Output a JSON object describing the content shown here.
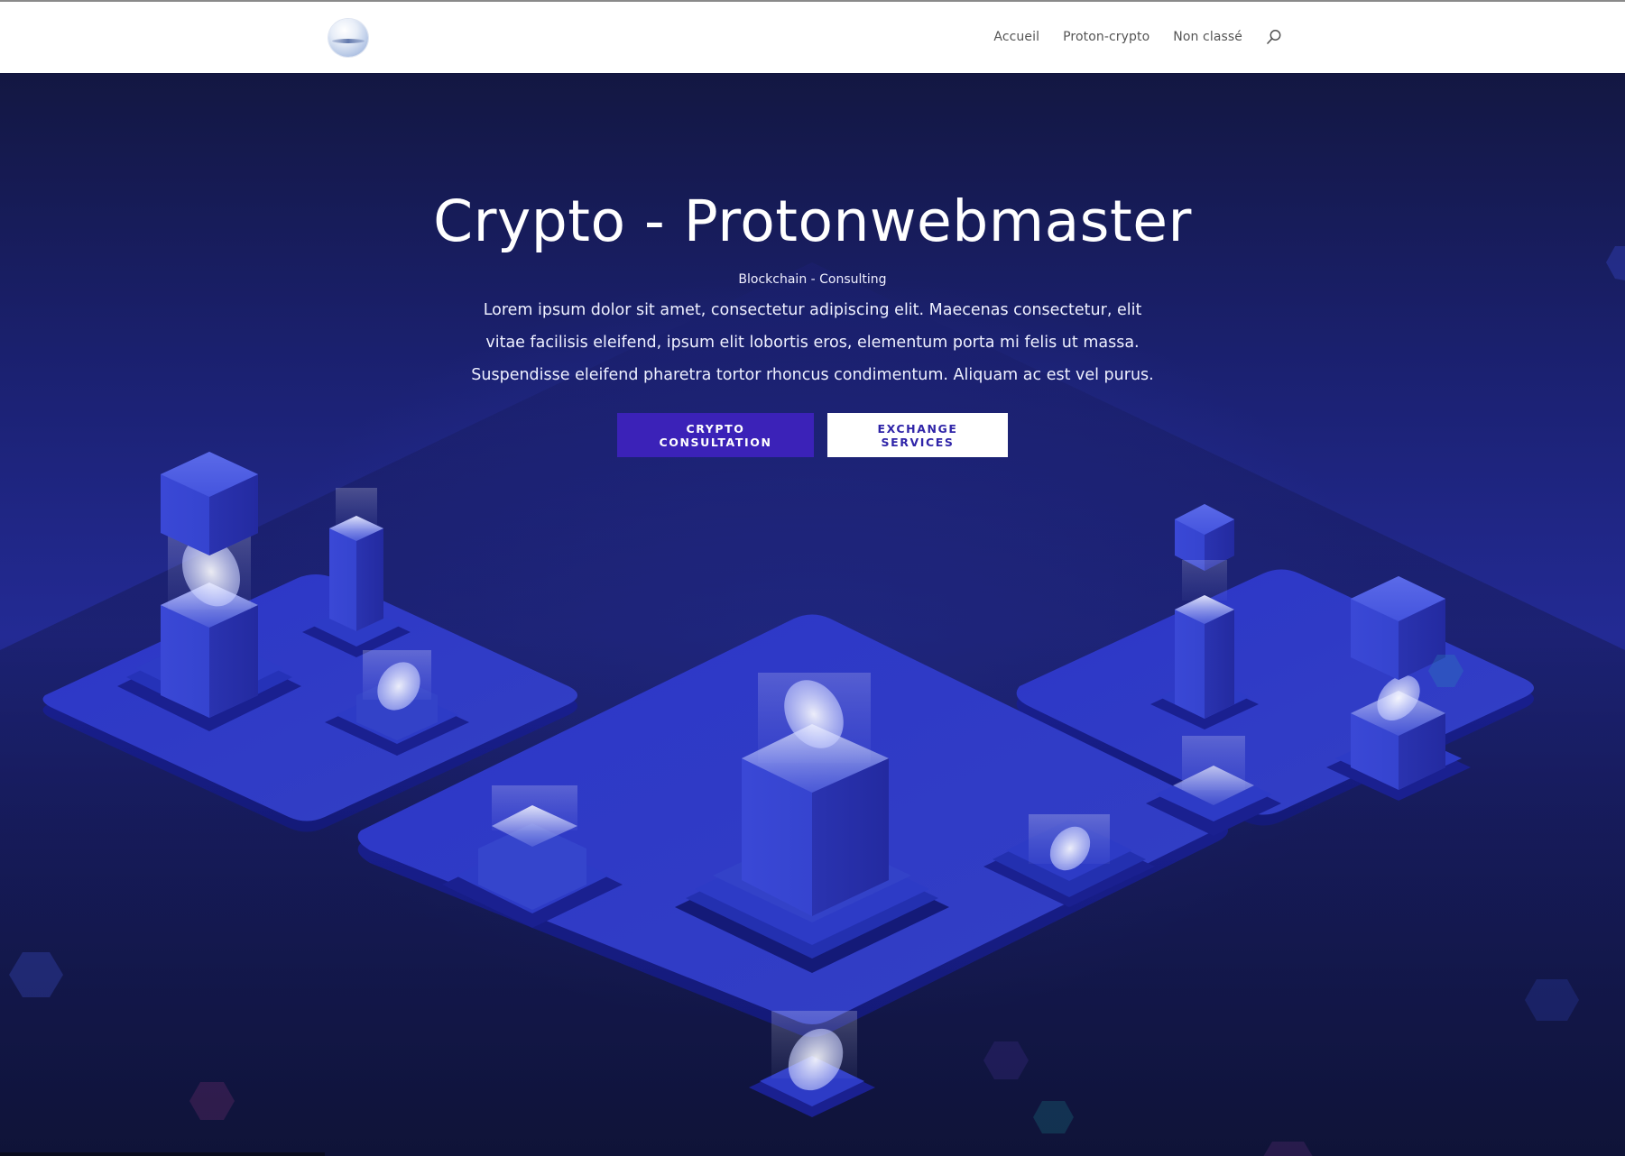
{
  "header": {
    "logo_name": "globe-logo",
    "nav": [
      {
        "label": "Accueil"
      },
      {
        "label": "Proton-crypto"
      },
      {
        "label": "Non classé"
      }
    ],
    "search_icon": "search-icon"
  },
  "hero": {
    "title": "Crypto - Protonwebmaster",
    "subtitle": "Blockchain - Consulting",
    "text": "Lorem ipsum dolor sit amet, consectetur adipiscing elit. Maecenas consectetur, elit vitae facilisis eleifend, ipsum elit lobortis eros, elementum porta mi felis ut massa. Suspendisse eleifend pharetra tortor rhoncus condimentum. Aliquam ac est vel purus.",
    "buttons": {
      "primary_label": "CRYPTO CONSULTATION",
      "secondary_label": "EXCHANGE SERVICES"
    }
  },
  "colors": {
    "primary_button": "#3b22b8",
    "secondary_button_text": "#2f24a8",
    "hero_background": "#1b2172"
  }
}
